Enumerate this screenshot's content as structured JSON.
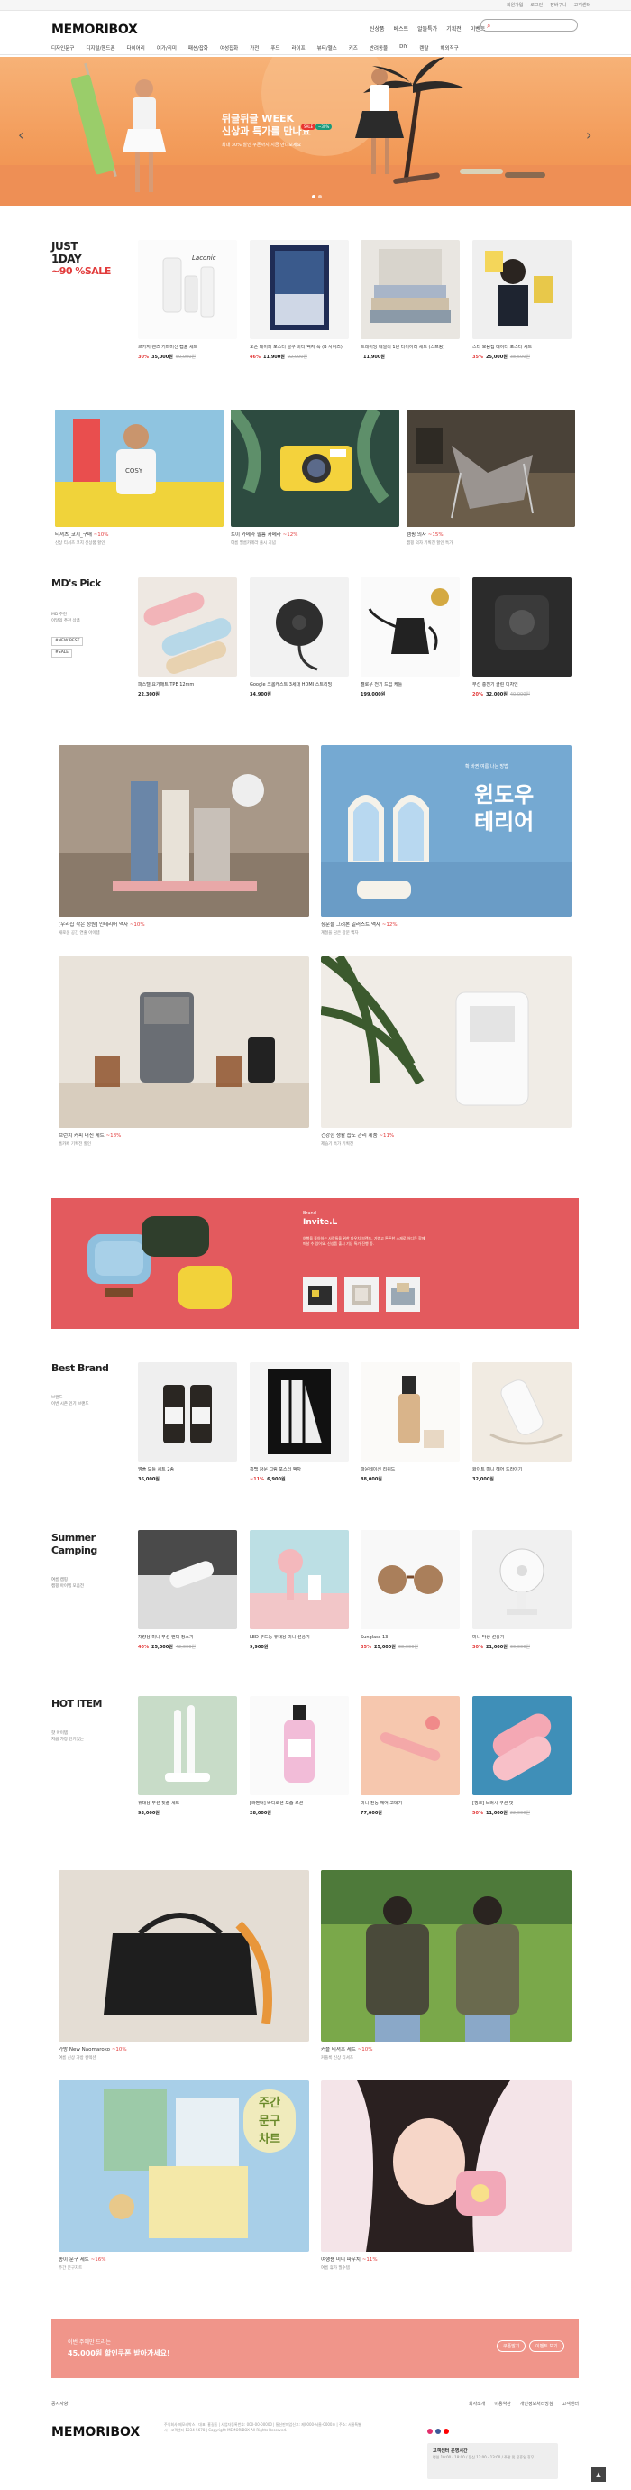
{
  "topbar": {
    "links": [
      "회원가입",
      "로그인",
      "장바구니",
      "고객센터"
    ]
  },
  "header": {
    "logo": "MEMORIBOX",
    "utils": [
      "신상품",
      "베스트",
      "알뜰특가",
      "기획전",
      "이벤트"
    ],
    "search_placeholder": ""
  },
  "gnb": [
    "디자인문구",
    "디지털/핸드폰",
    "다이어리",
    "여가/취미",
    "패션/잡화",
    "여성잡화",
    "가전",
    "푸드",
    "라이프",
    "뷰티/헬스",
    "키즈",
    "반려동물",
    "DIY",
    "렌탈",
    "해외직구"
  ],
  "hero": {
    "title_line1": "뒤글뒤글 WEEK",
    "title_line2": "신상과 특가를 만나요",
    "badge1": "SALE",
    "badge2": "~30%",
    "sub": "최대 30% 할인 쿠폰까지 지금 만나보세요"
  },
  "justday": {
    "title1": "JUST",
    "title2": "1DAY",
    "sale": "~90 %SALE",
    "items": [
      {
        "name": "르카지 렌즈 커피머신 캡슐 세트",
        "pct": "30%",
        "price": "35,000원",
        "old": "50,000원"
      },
      {
        "name": "오픈 페이퍼 포스터 블루 바다 액자 폭 (B 사이즈)",
        "pct": "46%",
        "price": "11,900원",
        "old": "22,000원"
      },
      {
        "name": "트레이딩 데일리 1년 다이어리 세트 (스프링)",
        "pct": "",
        "price": "11,900원",
        "old": ""
      },
      {
        "name": "스타 모음집 데이터 포스터 세트",
        "pct": "35%",
        "price": "25,000원",
        "old": "38,500원"
      }
    ]
  },
  "trio": [
    {
      "name": "티셔츠_코지_구매",
      "pct": "~10%",
      "desc": "신상 티셔츠 코지 신상품 할인"
    },
    {
      "name": "토이 카메라 필름 카메라",
      "pct": "~12%",
      "desc": "여름 필름카메라 출시 기념"
    },
    {
      "name": "캠핑 의자",
      "pct": "~15%",
      "desc": "캠핑 의자 기획전 할인 특가"
    }
  ],
  "mdpick": {
    "title": "MD's Pick",
    "desc1": "MD 추천",
    "desc2": "이달의 추천 상품",
    "tags": [
      "#NEW BEST",
      "#SALE"
    ],
    "items": [
      {
        "name": "파스텔 요가매트 TPE 12mm",
        "price": "22,300원"
      },
      {
        "name": "Google 크롬캐스트 3세대 HDMI 스트리밍",
        "price": "34,900원"
      },
      {
        "name": "펠로우 전기 드립 케틀",
        "price": "199,000원"
      },
      {
        "name": "무선 충전기 클린 디자인",
        "pct": "20%",
        "price": "32,000원",
        "old": "40,000원"
      }
    ]
  },
  "quad": [
    {
      "name": "[우리집 작은 정원] 인테리어 액자",
      "pct": "~10%",
      "desc": "새로운 공간 연출 아이템"
    },
    {
      "name": "창문을 그려본 일러스트 액자",
      "pct": "~12%",
      "desc": "계절을 담은 창문 액자"
    },
    {
      "name": "브런치 커피 머신 세트",
      "pct": "~18%",
      "desc": "홈카페 기획전 할인"
    },
    {
      "name": "건강한 생활 습도 관리 제품",
      "pct": "~11%",
      "desc": "제습기 특가 기획전"
    }
  ],
  "window_ad": {
    "small": "확 바뀐 여름 나는 방법",
    "title1": "윈도우",
    "title2": "테리어"
  },
  "redbanner": {
    "label": "Brand",
    "title": "Invite.L",
    "desc": "여행을 좋아하는 사람들을 위한 파우치 브랜드. 가볍고 튼튼한 소재로 어디든 함께 떠날 수 있어요. 신상품 출시 기념 특가 진행 중."
  },
  "bestbrand": {
    "title": "Best Brand",
    "sub1": "브랜드",
    "sub2": "이번 시즌 인기 브랜드",
    "items": [
      {
        "name": "앰플 보틀 세트 2종",
        "price": "36,000원"
      },
      {
        "name": "흑백 창문 그림 포스터 액자",
        "pct": "~11%",
        "price": "6,900원"
      },
      {
        "name": "파운데이션 리퀴드",
        "price": "88,000원"
      },
      {
        "name": "화이트 미니 헤어 드라이기",
        "price": "32,000원"
      }
    ]
  },
  "summer": {
    "title1": "Summer",
    "title2": "Camping",
    "sub1": "여름 캠핑",
    "sub2": "캠핑 아이템 모음전",
    "items": [
      {
        "name": "차량용 미니 무선 핸디 청소기",
        "pct": "40%",
        "price": "25,000원",
        "old": "42,000원"
      },
      {
        "name": "LED 무드등 휴대용 미니 선풍기",
        "price": "9,900원"
      },
      {
        "name": "Sunglass 13",
        "pct": "35%",
        "price": "25,000원",
        "old": "38,000원"
      },
      {
        "name": "미니 탁상 선풍기",
        "pct": "30%",
        "price": "21,000원",
        "old": "30,000원"
      }
    ]
  },
  "hotitem": {
    "title": "HOT ITEM",
    "sub1": "핫 아이템",
    "sub2": "지금 가장 인기있는",
    "items": [
      {
        "name": "휴대용 무선 칫솔 세트",
        "price": "93,000원"
      },
      {
        "name": "[라벤더] 바디로션 보습 로션",
        "price": "28,000원"
      },
      {
        "name": "미니 전동 헤어 고데기",
        "price": "77,000원"
      },
      {
        "name": "[핑크] 브러시 쿠션 빗",
        "pct": "50%",
        "price": "11,000원",
        "old": "22,000원"
      }
    ]
  },
  "bottomquad": [
    {
      "name": "가방 New Naomaroko",
      "pct": "~10%",
      "desc": "여름 신상 가방 컬렉션"
    },
    {
      "name": "커플 티셔츠 세트",
      "pct": "~10%",
      "desc": "커플룩 신상 티셔츠"
    },
    {
      "name": "종이 문구 세트",
      "pct": "~16%",
      "desc": "주간 문구차트"
    },
    {
      "name": "여행용 미니 파우치",
      "pct": "~11%",
      "desc": "여름 휴가 필수템"
    }
  ],
  "chart_ad": {
    "l1": "주간",
    "l2": "문구",
    "l3": "차트"
  },
  "coupon": {
    "line1": "이번 주에만 드리는",
    "line2": "45,000원 할인쿠폰 받아가세요!",
    "btn1": "쿠폰받기",
    "btn2": "이벤트 보기"
  },
  "footnav": {
    "left": "공지사항",
    "links": [
      "회사소개",
      "이용약관",
      "개인정보처리방침",
      "고객센터"
    ]
  },
  "footer": {
    "logo": "MEMORIBOX",
    "info": "주식회사 메모리박스 | 대표: 홍길동 | 사업자등록번호: 000-00-00000 | 통신판매업신고: 제0000-서울-0000호 | 주소: 서울특별시 | 고객센터 1234-5678 | Copyright MEMORIBOX All Rights Reserved.",
    "cs_title": "고객센터 운영시간",
    "cs_desc": "평일 10:00 - 18:00 / 점심 12:00 - 13:00 / 주말 및 공휴일 휴무"
  },
  "colors": {
    "accent": "#e23b3b",
    "hero": "#f39d5c",
    "banner": "#e35a5e",
    "coupon": "#f0958a",
    "window": "#75a9d2"
  }
}
